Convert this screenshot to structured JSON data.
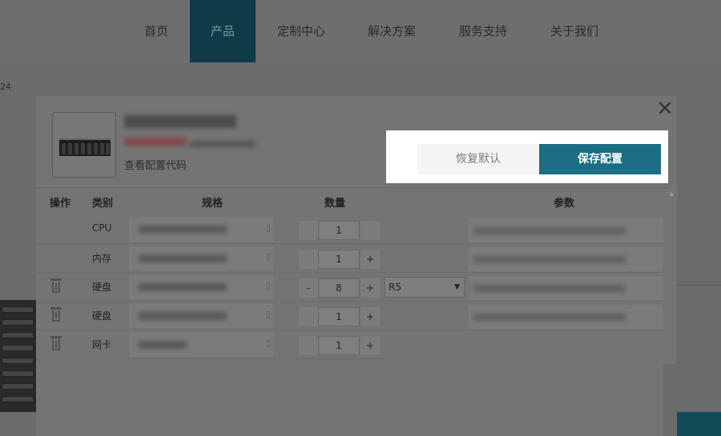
{
  "nav": {
    "items": [
      {
        "label": "首页"
      },
      {
        "label": "产品"
      },
      {
        "label": "定制中心"
      },
      {
        "label": "解决方案"
      },
      {
        "label": "服务支持"
      },
      {
        "label": "关于我们"
      }
    ],
    "active_index": 1
  },
  "background": {
    "fragment_text": "24"
  },
  "modal": {
    "close_label": "×",
    "product": {
      "view_code_label": "查看配置代码"
    },
    "actions": {
      "reset_label": "恢复默认",
      "save_label": "保存配置"
    },
    "table": {
      "headers": {
        "op": "操作",
        "category": "类别",
        "spec": "规格",
        "qty": "数量",
        "params": "参数"
      },
      "rows": [
        {
          "category": "CPU",
          "qty": "1",
          "deletable": false,
          "minus": "",
          "plus": ""
        },
        {
          "category": "内存",
          "qty": "1",
          "deletable": false,
          "minus": "",
          "plus": "+"
        },
        {
          "category": "硬盘",
          "qty": "8",
          "deletable": true,
          "minus": "-",
          "plus": "+",
          "raid": "R5"
        },
        {
          "category": "硬盘",
          "qty": "1",
          "deletable": true,
          "minus": "",
          "plus": "+"
        },
        {
          "category": "网卡",
          "qty": "1",
          "deletable": true,
          "minus": "",
          "plus": "+"
        }
      ]
    }
  },
  "colors": {
    "accent": "#1c6e84",
    "nav_active": "#0e3b47"
  }
}
